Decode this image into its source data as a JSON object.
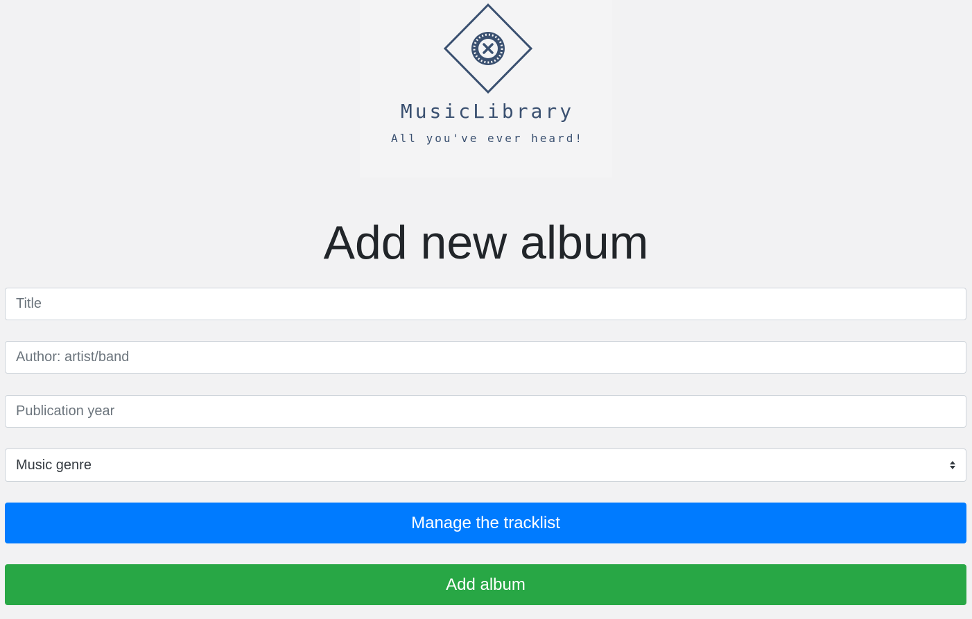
{
  "brand": {
    "name": "MusicLibrary",
    "tagline": "All you've ever heard!",
    "logo_icon": "vinyl-diamond-icon",
    "color": "#3a5070"
  },
  "form": {
    "title": "Add new album",
    "title_placeholder": "Title",
    "author_placeholder": "Author: artist/band",
    "year_placeholder": "Publication year",
    "genre_selected": "Music genre",
    "tracklist_button": "Manage the tracklist",
    "submit_button": "Add album"
  },
  "colors": {
    "primary": "#007bff",
    "success": "#28a745",
    "background": "#f2f2f3"
  }
}
